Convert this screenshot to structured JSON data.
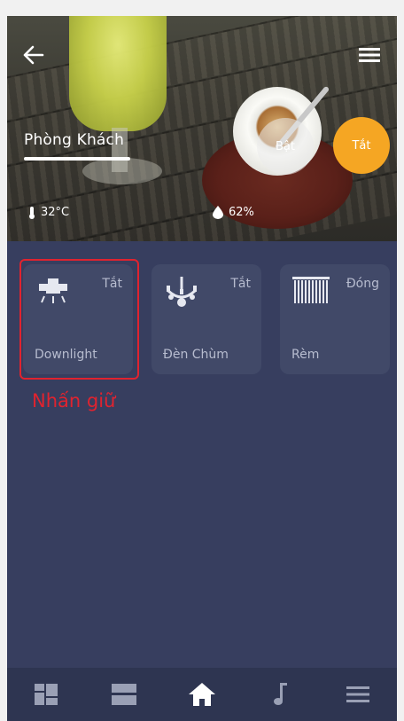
{
  "header": {
    "room_name": "Phòng Khách",
    "on_label": "Bật",
    "off_label": "Tắt",
    "temperature": "32°C",
    "humidity": "62%"
  },
  "devices": [
    {
      "name": "Downlight",
      "state": "Tắt",
      "icon": "downlight-icon"
    },
    {
      "name": "Đèn Chùm",
      "state": "Tắt",
      "icon": "chandelier-icon"
    },
    {
      "name": "Rèm",
      "state": "Đóng",
      "icon": "curtain-icon"
    }
  ],
  "hint_text": "Nhấn giữ",
  "colors": {
    "background": "#373e5f",
    "tile": "#414968",
    "accent_off_button": "#f5a623",
    "highlight": "#e0232f",
    "nav_background": "#2e3551"
  },
  "nav": [
    {
      "icon": "grid-icon"
    },
    {
      "icon": "scenes-icon"
    },
    {
      "icon": "home-icon",
      "active": true
    },
    {
      "icon": "music-icon"
    },
    {
      "icon": "menu-icon"
    }
  ]
}
